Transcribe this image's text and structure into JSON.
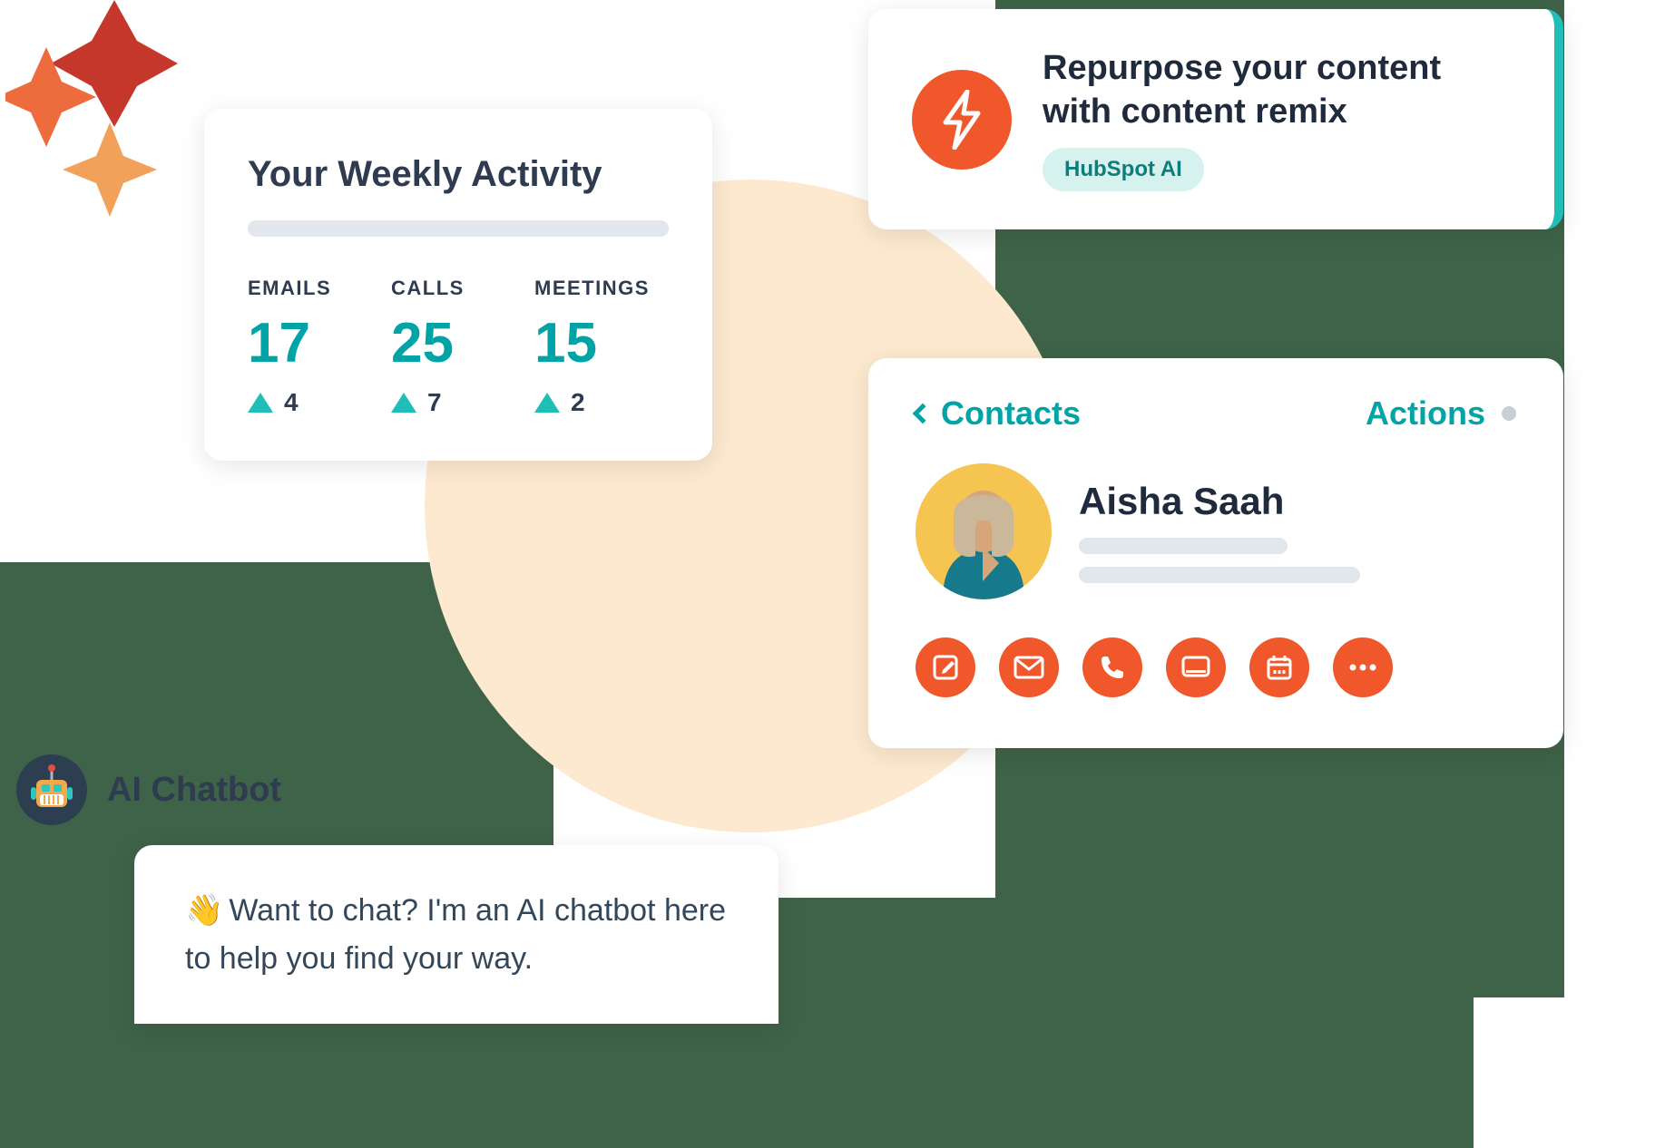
{
  "weekly": {
    "title": "Your Weekly Activity",
    "metrics": [
      {
        "label": "EMAILS",
        "value": "17",
        "delta": "4"
      },
      {
        "label": "CALLS",
        "value": "25",
        "delta": "7"
      },
      {
        "label": "MEETINGS",
        "value": "15",
        "delta": "2"
      }
    ]
  },
  "remix": {
    "title": "Repurpose your content with content remix",
    "pill": "HubSpot AI"
  },
  "contacts": {
    "back_label": "Contacts",
    "actions_label": "Actions",
    "name": "Aisha Saah",
    "action_icons": [
      "edit-icon",
      "mail-icon",
      "phone-icon",
      "screen-icon",
      "calendar-icon",
      "more-icon"
    ]
  },
  "chatbot": {
    "label": "AI Chatbot",
    "wave": "👋",
    "message": "Want to chat? I'm an AI chatbot here to help you find your way."
  },
  "colors": {
    "teal": "#00a4a6",
    "orange": "#f0572b",
    "dark": "#2e3b50",
    "green": "#3e6348"
  }
}
